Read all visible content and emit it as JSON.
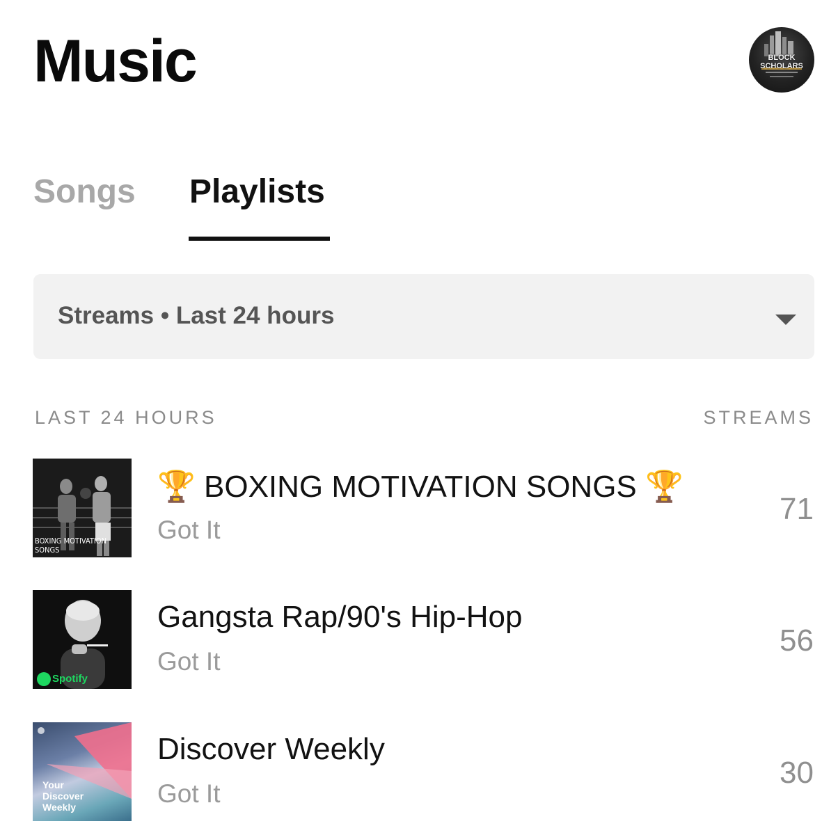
{
  "header": {
    "title": "Music",
    "avatar_text": "BLOCK SCHOLARS"
  },
  "tabs": [
    {
      "label": "Songs",
      "active": false
    },
    {
      "label": "Playlists",
      "active": true
    }
  ],
  "filter": {
    "label": "Streams • Last 24 hours",
    "icon": "dropdown-caret-icon"
  },
  "list": {
    "left_header": "LAST 24 HOURS",
    "right_header": "STREAMS",
    "rows": [
      {
        "title": "🏆 BOXING MOTIVATION SONGS 🏆",
        "subtitle": "Got It",
        "count": "71",
        "cover_caption": "BOXING MOTIVATION SONGS"
      },
      {
        "title": "Gangsta Rap/90's Hip-Hop",
        "subtitle": "Got It",
        "count": "56",
        "cover_caption": "Spotify"
      },
      {
        "title": "Discover Weekly",
        "subtitle": "Got It",
        "count": "30",
        "cover_caption": "Your Discover Weekly"
      }
    ]
  },
  "colors": {
    "active_tab": "#111111",
    "inactive_tab": "#a8a8a8",
    "filter_bg": "#f2f2f2",
    "muted_text": "#9a9a9a",
    "spotify_green": "#1ed760"
  }
}
